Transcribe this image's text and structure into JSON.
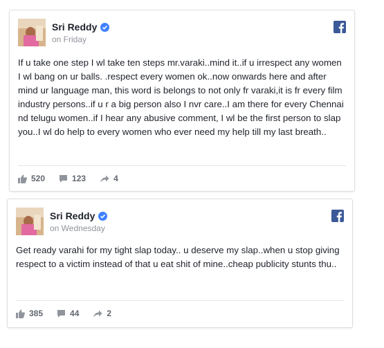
{
  "posts": [
    {
      "author": "Sri Reddy",
      "time": "on Friday",
      "text": "If u take one step I wl take ten steps mr.varaki..mind it..if u irrespect any women I wl bang on ur balls. .respect every women ok..now onwards here and after mind ur language man, this word is belongs to not only fr varaki,it is fr every film industry persons..if u r a big person also I nvr care..I am there for every Chennai nd telugu women..if I hear any abusive comment, I wl be the first person to slap you..I wl do help to every women who ever need my help till my last breath..",
      "likes": "520",
      "comments": "123",
      "shares": "4"
    },
    {
      "author": "Sri Reddy",
      "time": "on Wednesday",
      "text": "Get ready varahi for my tight slap today.. u deserve my slap..when u stop giving respect to a victim instead of that u eat shit of mine..cheap publicity stunts thu..",
      "likes": "385",
      "comments": "44",
      "shares": "2"
    }
  ],
  "icons": {
    "like": "thumbs-up-icon",
    "comment": "speech-bubble-icon",
    "share": "share-arrow-icon",
    "platform": "facebook-icon",
    "verified": "verified-badge-icon"
  },
  "colors": {
    "facebook_blue": "#3b5998",
    "verified_blue": "#4080ff",
    "meta_gray": "#90949c",
    "action_gray": "#616770"
  }
}
